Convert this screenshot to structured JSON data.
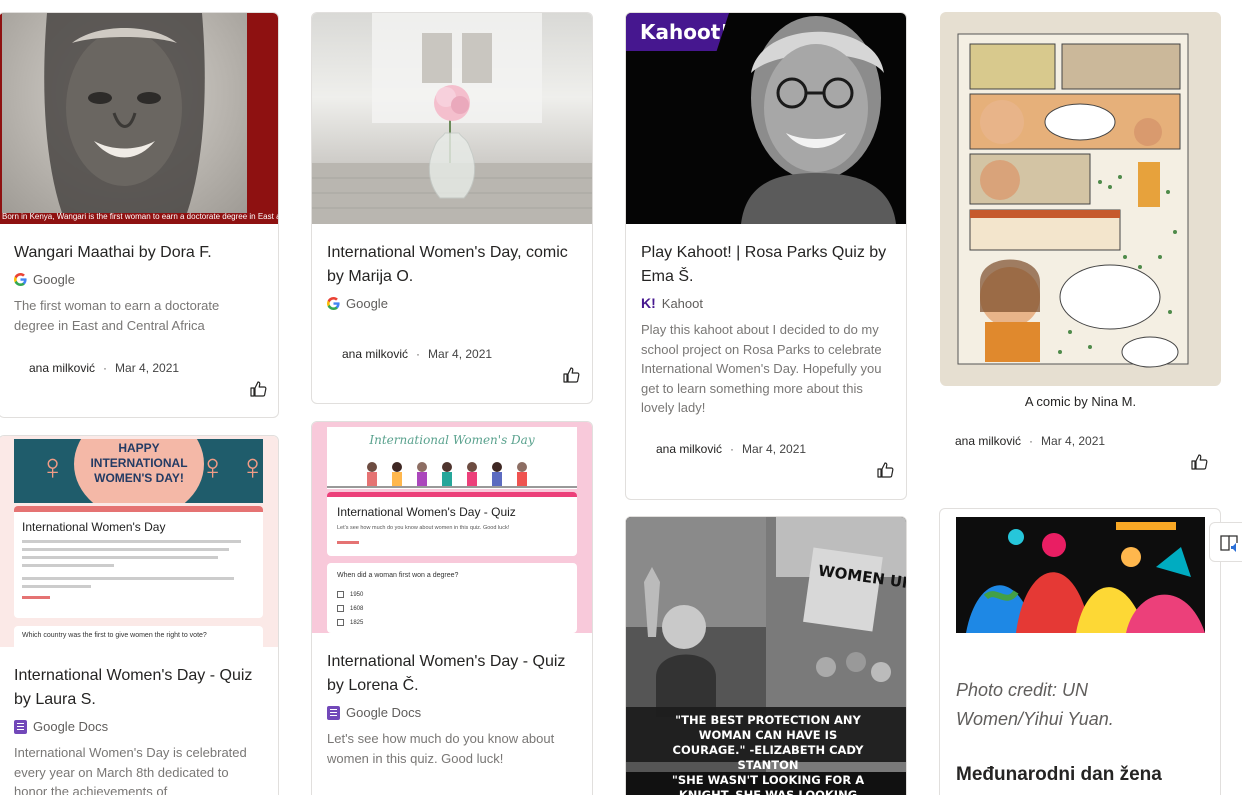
{
  "cards": [
    {
      "title": "Wangari Maathai by Dora F.",
      "source": "Google",
      "description": "The first woman to earn a doctorate degree in East and Central Africa",
      "author": "ana milković",
      "date": "Mar 4, 2021",
      "image_caption": "Born in Kenya, Wangari is the first woman to earn a doctorate degree in East and Central Africa"
    },
    {
      "title": "International Women's Day, comic by Marija O.",
      "source": "Google",
      "author": "ana milković",
      "date": "Mar 4, 2021"
    },
    {
      "title": "Play Kahoot! | Rosa Parks Quiz by Ema Š.",
      "source": "Kahoot",
      "description": "Play this kahoot about I decided to do my school project on Rosa Parks to celebrate International Women's Day. Hopefully you get to learn something more about this lovely lady!",
      "author": "ana milković",
      "date": "Mar 4, 2021",
      "image_logo": "Kahoot!"
    },
    {
      "caption": "A comic by Nina M.",
      "author": "ana milković",
      "date": "Mar 4, 2021"
    },
    {
      "title": "International Women's Day - Quiz by Laura S.",
      "source": "Google Docs",
      "description": "International Women's Day is celebrated every year on March 8th dedicated to honor the achievements of",
      "image_banner": "HAPPY INTERNATIONAL WOMEN'S DAY!",
      "form_title": "International Women's Day",
      "form_question": "Which country was the first to give women the right to vote?"
    },
    {
      "title": "International Women's Day - Quiz by Lorena Č.",
      "source": "Google Docs",
      "description": "Let's see how much do you know about women in this quiz. Good luck!",
      "form_header": "International Women's Day",
      "form_title": "International Women's Day - Quiz",
      "form_subtitle": "Let's see how much do you know about women in this quiz. Good luck!",
      "form_question": "When did a woman first won a degree?",
      "form_options": [
        "1950",
        "1608",
        "1825"
      ]
    },
    {
      "poster_sign": "WOMEN UNITE!",
      "quote_1": "\"THE BEST PROTECTION ANY WOMAN CAN HAVE IS COURAGE.\" -ELIZABETH CADY STANTON",
      "quote_2": "\"SHE WASN'T LOOKING FOR A KNIGHT, SHE WAS LOOKING FOR A"
    },
    {
      "photo_credit": "Photo credit: UN Women/Yihui Yuan.",
      "title": "Međunarodni dan žena"
    }
  ],
  "colors": {
    "card_border": "#e1dfdd",
    "google_docs": "#7248b9",
    "kahoot": "#46178f",
    "portrait_bg": "#8e1111"
  }
}
